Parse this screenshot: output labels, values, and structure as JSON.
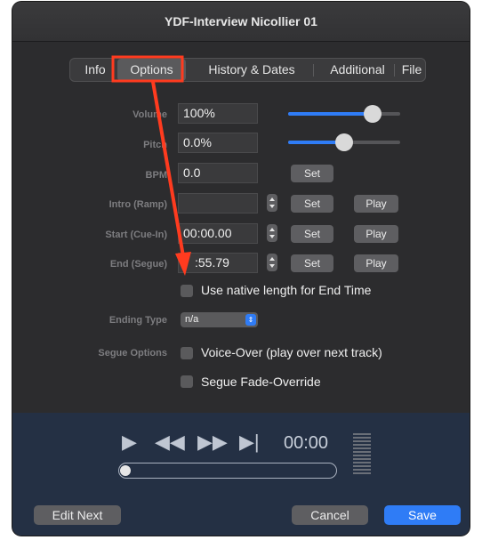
{
  "window": {
    "title": "YDF-Interview Nicollier 01"
  },
  "tabs": [
    {
      "label": "Info"
    },
    {
      "label": "Options",
      "selected": true
    },
    {
      "label": "History & Dates"
    },
    {
      "label": "Additional"
    },
    {
      "label": "File"
    }
  ],
  "fields": {
    "volume": {
      "label": "Volume",
      "value": "100%",
      "slider_level": 0.75
    },
    "pitch": {
      "label": "Pitch",
      "value": "0.0%",
      "slider_level": 0.5
    },
    "bpm": {
      "label": "BPM",
      "value": "0.0"
    },
    "intro": {
      "label": "Intro (Ramp)",
      "value": ""
    },
    "start": {
      "label": "Start (Cue-In)",
      "value": "00:00.00"
    },
    "end": {
      "label": "End (Segue)",
      "value": ":55.79"
    }
  },
  "buttons": {
    "set": "Set",
    "play": "Play"
  },
  "checkboxes": {
    "native_length": "Use native length for End Time",
    "voice_over": "Voice-Over (play over next track)",
    "segue_fade": "Segue Fade-Override"
  },
  "ending_type": {
    "label": "Ending Type",
    "value": "n/a"
  },
  "segue_options": {
    "label": "Segue Options"
  },
  "transport": {
    "time": "00:00",
    "position": 0.0
  },
  "footer": {
    "edit_next": "Edit Next",
    "cancel": "Cancel",
    "save": "Save"
  },
  "annotation": {
    "color": "#ff3b1f"
  },
  "colors": {
    "accent": "#2f7cf6",
    "background": "#2c2c2e",
    "transport_bg": "#243044"
  }
}
